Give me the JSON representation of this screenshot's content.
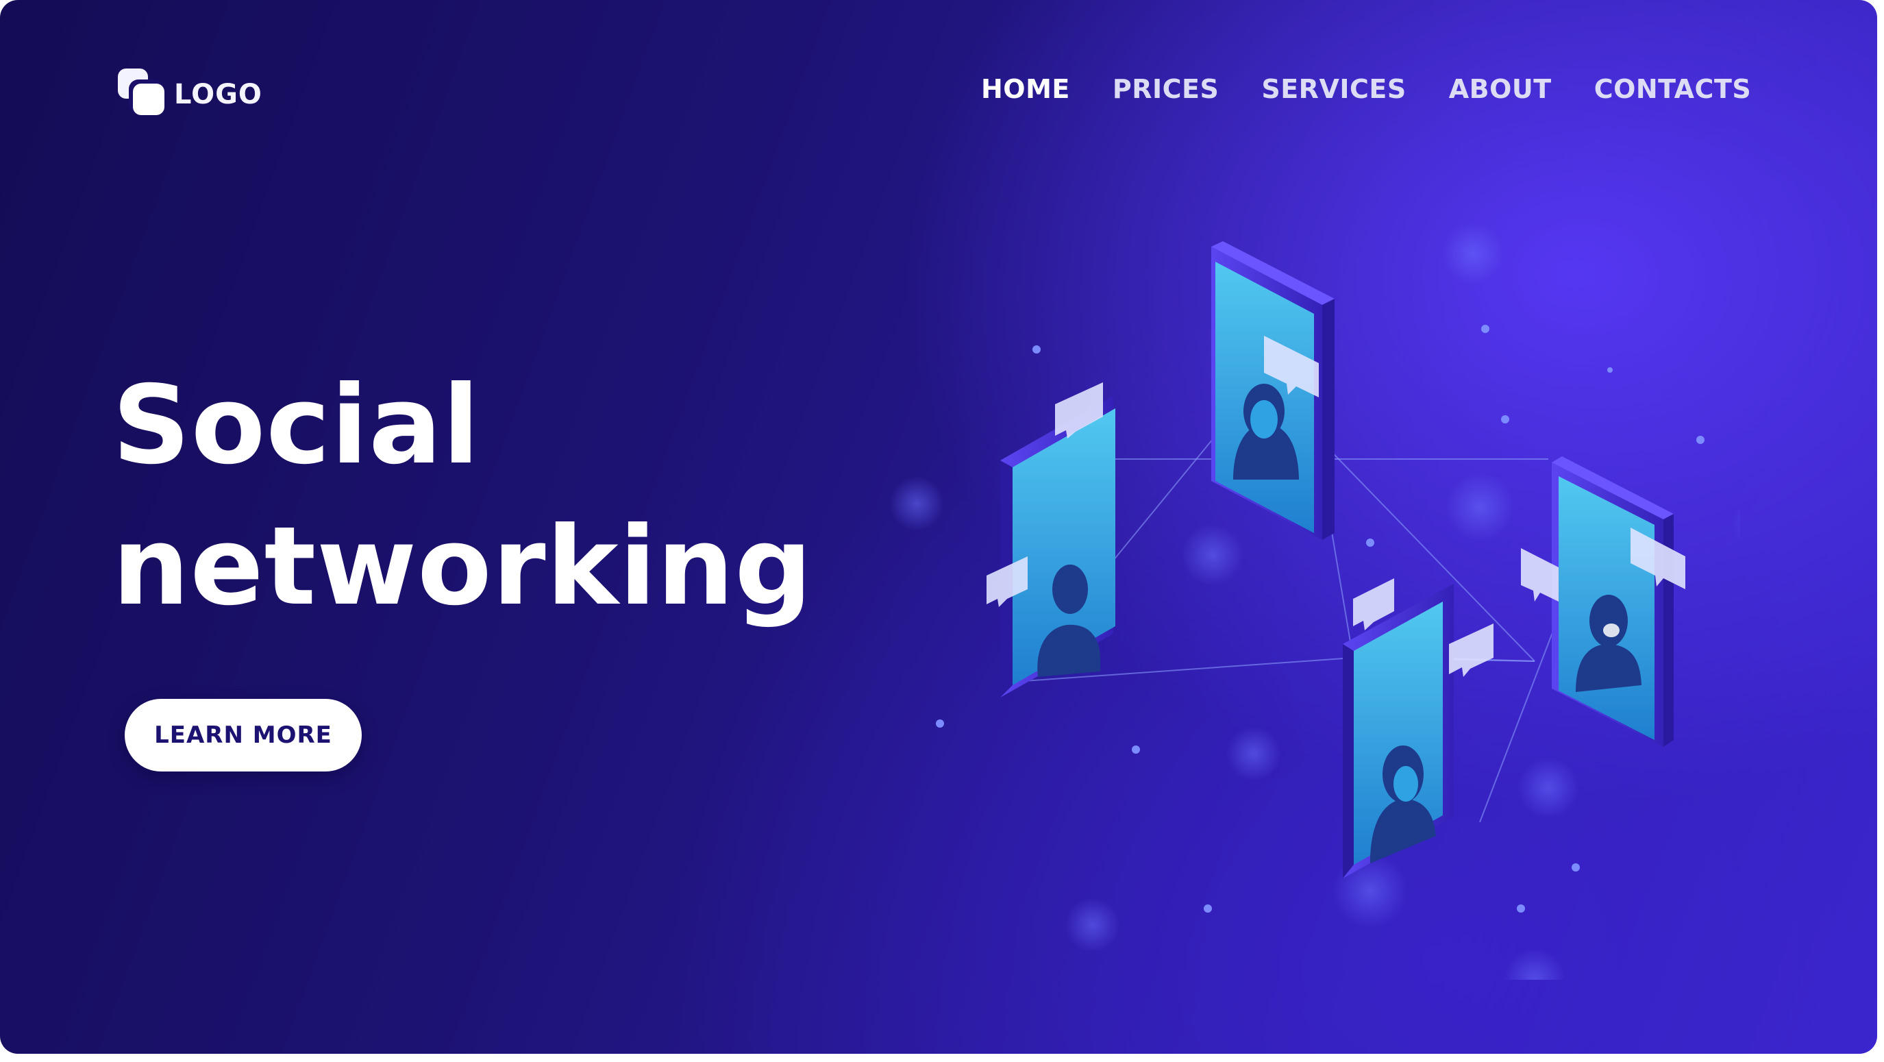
{
  "brand": {
    "logo_text": "LOGO",
    "logo_icon": "logo-mark-icon"
  },
  "nav": {
    "items": [
      {
        "label": "HOME",
        "active": true
      },
      {
        "label": "PRICES",
        "active": false
      },
      {
        "label": "SERVICES",
        "active": false
      },
      {
        "label": "ABOUT",
        "active": false
      },
      {
        "label": "CONTACTS",
        "active": false
      }
    ]
  },
  "hero": {
    "title_line1": "Social",
    "title_line2": "networking",
    "cta_label": "LEARN MORE"
  },
  "illustration": {
    "description_icon": "isometric-social-network-phones-icon",
    "phone_count": 4
  },
  "colors": {
    "bg_dark": "#140c55",
    "bg_accent": "#3a26cc",
    "phone_frame": "#4a35e0",
    "phone_screen": "#36b6e6",
    "text": "#ffffff"
  }
}
